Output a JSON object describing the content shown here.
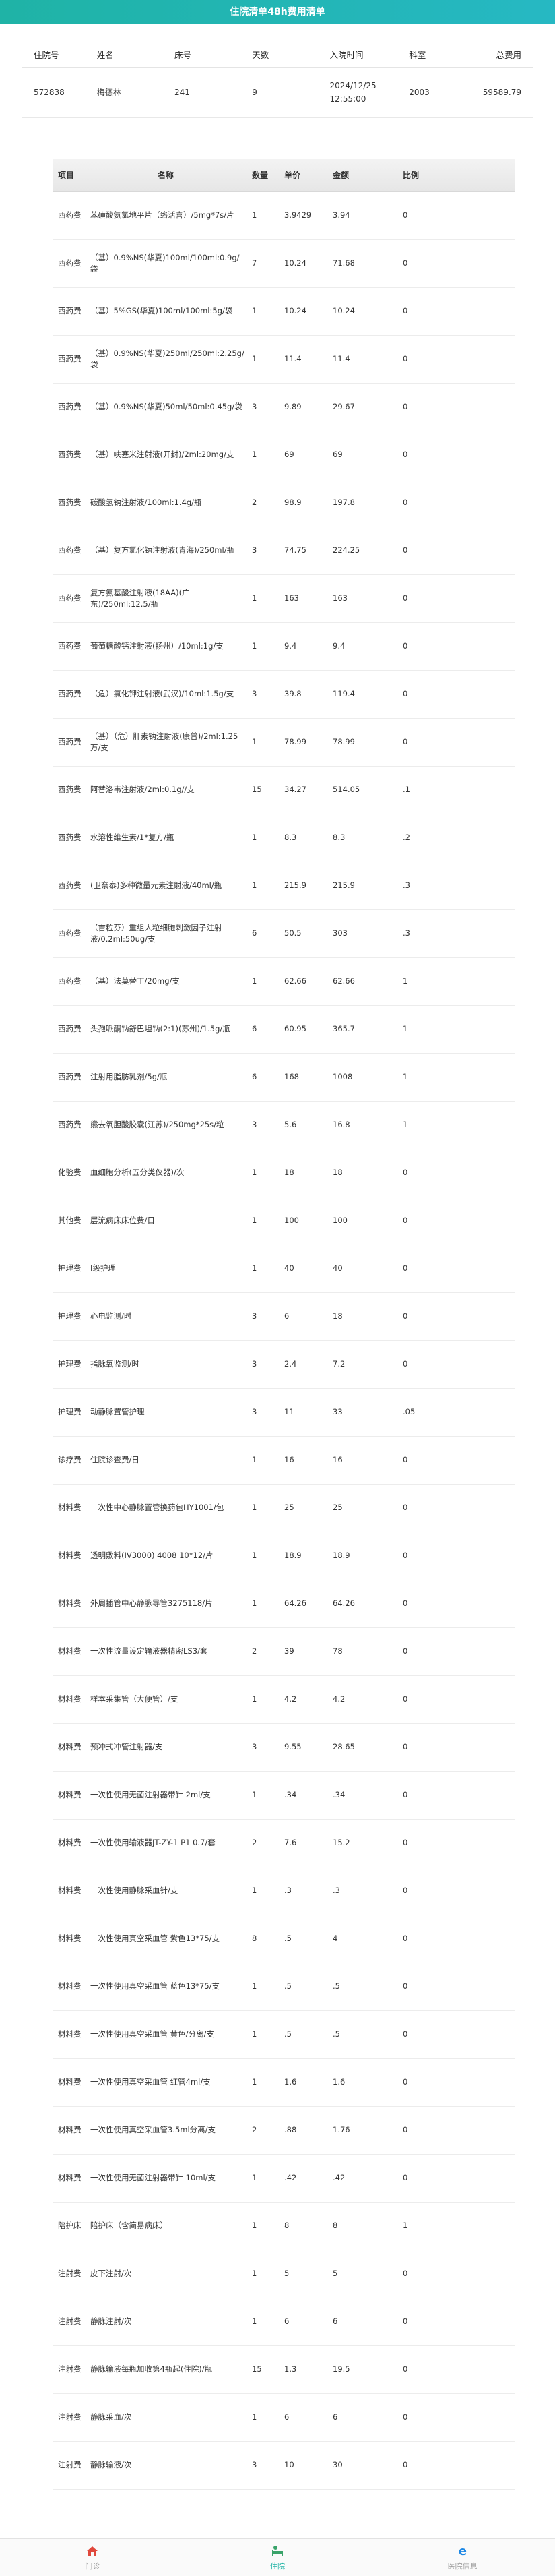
{
  "header": {
    "title": "住院清单48h费用清单"
  },
  "patient": {
    "headers": [
      "住院号",
      "姓名",
      "床号",
      "天数",
      "入院时间",
      "科室",
      "总费用"
    ],
    "values": [
      "572838",
      "梅德林",
      "241",
      "9",
      "2024/12/25\n12:55:00",
      "2003",
      "59589.79"
    ]
  },
  "items": {
    "headers": [
      "项目",
      "名称",
      "数量",
      "单价",
      "金额",
      "比例"
    ],
    "rows": [
      [
        "西药费",
        "苯磺酸氨氯地平片（络活喜）/5mg*7s/片",
        "1",
        "3.9429",
        "3.94",
        "0"
      ],
      [
        "西药费",
        "（基）0.9%NS(华夏)100ml/100ml:0.9g/袋",
        "7",
        "10.24",
        "71.68",
        "0"
      ],
      [
        "西药费",
        "（基）5%GS(华夏)100ml/100ml:5g/袋",
        "1",
        "10.24",
        "10.24",
        "0"
      ],
      [
        "西药费",
        "（基）0.9%NS(华夏)250ml/250ml:2.25g/袋",
        "1",
        "11.4",
        "11.4",
        "0"
      ],
      [
        "西药费",
        "（基）0.9%NS(华夏)50ml/50ml:0.45g/袋",
        "3",
        "9.89",
        "29.67",
        "0"
      ],
      [
        "西药费",
        "（基）呋塞米注射液(开封)/2ml:20mg/支",
        "1",
        "69",
        "69",
        "0"
      ],
      [
        "西药费",
        "碳酸氢钠注射液/100ml:1.4g/瓶",
        "2",
        "98.9",
        "197.8",
        "0"
      ],
      [
        "西药费",
        "（基）复方氯化钠注射液(青海)/250ml/瓶",
        "3",
        "74.75",
        "224.25",
        "0"
      ],
      [
        "西药费",
        "复方氨基酸注射液(18AA)(广东)/250ml:12.5/瓶",
        "1",
        "163",
        "163",
        "0"
      ],
      [
        "西药费",
        "葡萄糖酸钙注射液(扬州）/10ml:1g/支",
        "1",
        "9.4",
        "9.4",
        "0"
      ],
      [
        "西药费",
        "（危）氯化钾注射液(武汉)/10ml:1.5g/支",
        "3",
        "39.8",
        "119.4",
        "0"
      ],
      [
        "西药费",
        "（基）（危）肝素钠注射液(康普)/2ml:1.25万/支",
        "1",
        "78.99",
        "78.99",
        "0"
      ],
      [
        "西药费",
        "阿替洛韦注射液/2ml:0.1g//支",
        "15",
        "34.27",
        "514.05",
        ".1"
      ],
      [
        "西药费",
        "水溶性维生素/1*复方/瓶",
        "1",
        "8.3",
        "8.3",
        ".2"
      ],
      [
        "西药费",
        "(卫奈泰)多种微量元素注射液/40ml/瓶",
        "1",
        "215.9",
        "215.9",
        ".3"
      ],
      [
        "西药费",
        "（吉粒芬）重组人粒细胞刺激因子注射液/0.2ml:50ug/支",
        "6",
        "50.5",
        "303",
        ".3"
      ],
      [
        "西药费",
        "（基）法莫替丁/20mg/支",
        "1",
        "62.66",
        "62.66",
        "1"
      ],
      [
        "西药费",
        "头孢哌酮钠舒巴坦钠(2:1)(苏州)/1.5g/瓶",
        "6",
        "60.95",
        "365.7",
        "1"
      ],
      [
        "西药费",
        "注射用脂肪乳剂/5g/瓶",
        "6",
        "168",
        "1008",
        "1"
      ],
      [
        "西药费",
        "熊去氧胆酸胶囊(江苏)/250mg*25s/粒",
        "3",
        "5.6",
        "16.8",
        "1"
      ],
      [
        "化验费",
        "血细胞分析(五分类仪器)/次",
        "1",
        "18",
        "18",
        "0"
      ],
      [
        "其他费",
        "层流病床床位费/日",
        "1",
        "100",
        "100",
        "0"
      ],
      [
        "护理费",
        "Ⅰ级护理",
        "1",
        "40",
        "40",
        "0"
      ],
      [
        "护理费",
        "心电监测/时",
        "3",
        "6",
        "18",
        "0"
      ],
      [
        "护理费",
        "指脉氧监测/时",
        "3",
        "2.4",
        "7.2",
        "0"
      ],
      [
        "护理费",
        "动静脉置管护理",
        "3",
        "11",
        "33",
        ".05"
      ],
      [
        "诊疗费",
        "住院诊查费/日",
        "1",
        "16",
        "16",
        "0"
      ],
      [
        "材料费",
        "一次性中心静脉置管换药包HY1001/包",
        "1",
        "25",
        "25",
        "0"
      ],
      [
        "材料费",
        "透明敷料(IV3000) 4008 10*12/片",
        "1",
        "18.9",
        "18.9",
        "0"
      ],
      [
        "材料费",
        "外周插管中心静脉导管3275118/片",
        "1",
        "64.26",
        "64.26",
        "0"
      ],
      [
        "材料费",
        "一次性流量设定输液器精密LS3/套",
        "2",
        "39",
        "78",
        "0"
      ],
      [
        "材料费",
        "样本采集管（大便管）/支",
        "1",
        "4.2",
        "4.2",
        "0"
      ],
      [
        "材料费",
        "预冲式冲管注射器/支",
        "3",
        "9.55",
        "28.65",
        "0"
      ],
      [
        "材料费",
        "一次性使用无菌注射器带针 2ml/支",
        "1",
        ".34",
        ".34",
        "0"
      ],
      [
        "材料费",
        "一次性使用输液器JT-ZY-1 P1 0.7/套",
        "2",
        "7.6",
        "15.2",
        "0"
      ],
      [
        "材料费",
        "一次性使用静脉采血针/支",
        "1",
        ".3",
        ".3",
        "0"
      ],
      [
        "材料费",
        "一次性使用真空采血管 紫色13*75/支",
        "8",
        ".5",
        "4",
        "0"
      ],
      [
        "材料费",
        "一次性使用真空采血管 蓝色13*75/支",
        "1",
        ".5",
        ".5",
        "0"
      ],
      [
        "材料费",
        "一次性使用真空采血管 黄色/分离/支",
        "1",
        ".5",
        ".5",
        "0"
      ],
      [
        "材料费",
        "一次性使用真空采血管 红管4ml/支",
        "1",
        "1.6",
        "1.6",
        "0"
      ],
      [
        "材料费",
        "一次性使用真空采血管3.5ml分离/支",
        "2",
        ".88",
        "1.76",
        "0"
      ],
      [
        "材料费",
        "一次性使用无菌注射器带针 10ml/支",
        "1",
        ".42",
        ".42",
        "0"
      ],
      [
        "陪护床",
        "陪护床（含简易病床）",
        "1",
        "8",
        "8",
        "1"
      ],
      [
        "注射费",
        "皮下注射/次",
        "1",
        "5",
        "5",
        "0"
      ],
      [
        "注射费",
        "静脉注射/次",
        "1",
        "6",
        "6",
        "0"
      ],
      [
        "注射费",
        "静脉输液每瓶加收第4瓶起(住院)/瓶",
        "15",
        "1.3",
        "19.5",
        "0"
      ],
      [
        "注射费",
        "静脉采血/次",
        "1",
        "6",
        "6",
        "0"
      ],
      [
        "注射费",
        "静脉输液/次",
        "3",
        "10",
        "30",
        "0"
      ]
    ]
  },
  "tabbar": {
    "items": [
      {
        "label": "门诊",
        "icon": "home-icon",
        "color": "#e0483c"
      },
      {
        "label": "住院",
        "icon": "inpatient-icon",
        "color": "#3aa36a"
      },
      {
        "label": "医院信息",
        "icon": "browser-e-icon",
        "color": "#1e88e5"
      }
    ],
    "active": 1
  }
}
